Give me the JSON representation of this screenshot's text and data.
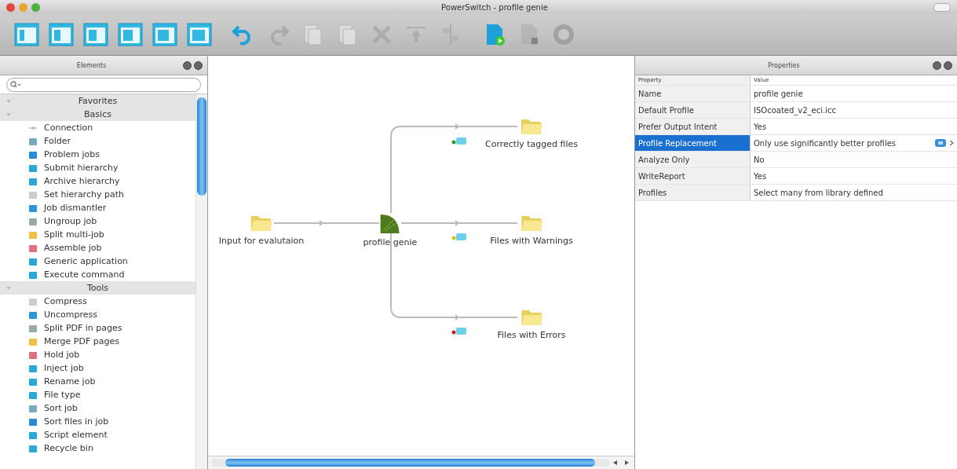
{
  "window": {
    "title": "PowerSwitch - profile genie"
  },
  "toolbar": [
    {
      "kind": "view",
      "disabled": false
    },
    {
      "kind": "view",
      "disabled": false
    },
    {
      "kind": "view",
      "disabled": false
    },
    {
      "kind": "view",
      "disabled": false
    },
    {
      "kind": "view",
      "disabled": false
    },
    {
      "kind": "view",
      "disabled": false
    },
    {
      "kind": "undo",
      "disabled": false
    },
    {
      "kind": "redo",
      "disabled": true
    },
    {
      "kind": "copy",
      "disabled": true
    },
    {
      "kind": "paste",
      "disabled": true
    },
    {
      "kind": "delete",
      "disabled": true
    },
    {
      "kind": "move-up",
      "disabled": true
    },
    {
      "kind": "align",
      "disabled": true
    },
    {
      "kind": "start",
      "disabled": false
    },
    {
      "kind": "stop",
      "disabled": true
    },
    {
      "kind": "help",
      "disabled": true
    }
  ],
  "elements": {
    "title": "Elements",
    "sections": [
      {
        "label": "Favorites"
      },
      {
        "label": "Basics",
        "items": [
          "Connection",
          "Folder",
          "Problem jobs",
          "Submit hierarchy",
          "Archive hierarchy",
          "Set hierarchy path",
          "Job dismantler",
          "Ungroup job",
          "Split multi-job",
          "Assemble job",
          "Generic application",
          "Execute command"
        ]
      },
      {
        "label": "Tools",
        "items": [
          "Compress",
          "Uncompress",
          "Split PDF in pages",
          "Merge PDF pages",
          "Hold job",
          "Inject job",
          "Rename job",
          "File type",
          "Sort job",
          "Sort files in job",
          "Script element",
          "Recycle bin"
        ]
      }
    ]
  },
  "canvas": {
    "nodes": [
      {
        "kind": "folder",
        "label": "Input for evalutaion"
      },
      {
        "kind": "flow-element",
        "label": "profile genie"
      },
      {
        "kind": "folder",
        "label": "Correctly tagged files"
      },
      {
        "kind": "folder",
        "label": "Files with Warnings"
      },
      {
        "kind": "folder",
        "label": "Files with Errors"
      }
    ],
    "connections": [
      {
        "color": "#2e9a2e"
      },
      {
        "color": "#d8c020"
      },
      {
        "color": "#d02020"
      }
    ]
  },
  "properties": {
    "title": "Properties",
    "columns": [
      "Property",
      "Value"
    ],
    "rows": [
      {
        "property": "Name",
        "value": "profile genie",
        "selected": false
      },
      {
        "property": "Default Profile",
        "value": "ISOcoated_v2_eci.icc",
        "selected": false
      },
      {
        "property": "Prefer Output Intent",
        "value": "Yes",
        "selected": false
      },
      {
        "property": "Profile Replacement",
        "value": "Only use significantly better profiles",
        "selected": true
      },
      {
        "property": "Analyze Only",
        "value": "No",
        "selected": false
      },
      {
        "property": "WriteReport",
        "value": "Yes",
        "selected": false
      },
      {
        "property": "Profiles",
        "value": "Select many from library defined",
        "selected": false
      }
    ]
  }
}
